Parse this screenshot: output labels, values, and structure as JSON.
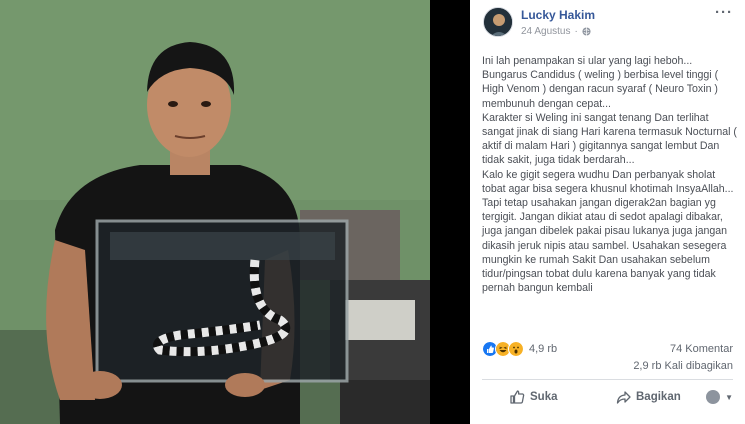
{
  "theme": {
    "link_color": "#365899",
    "text_color": "#4b4f56",
    "meta_color": "#90949c",
    "like_blue": "#1877f2",
    "laugh_yellow": "#f7b125"
  },
  "post": {
    "author": "Lucky Hakim",
    "date": "24 Agustus",
    "privacy_icon": "globe-icon",
    "more_icon": "more-options-icon",
    "text": [
      "Ini lah penampakan si ular yang lagi heboh...",
      "Bungarus Candidus ( weling ) berbisa level tinggi ( High Venom ) dengan racun syaraf ( Neuro Toxin ) membunuh dengan cepat...",
      "Karakter si Weling ini sangat tenang Dan terlihat sangat jinak di siang Hari karena termasuk Nocturnal ( aktif di malam Hari ) gigitannya sangat lembut Dan tidak sakit, juga tidak berdarah...",
      "Kalo ke gigit segera wudhu Dan perbanyak sholat tobat agar bisa segera khusnul khotimah InsyaAllah...",
      "Tapi tetap usahakan jangan digerak2an bagian yg tergigit. Jangan dikiat atau di sedot apalagi dibakar, juga jangan dibelek pakai pisau lukanya juga jangan dikasih jeruk nipis atau sambel. Usahakan sesegera mungkin ke rumah Sakit Dan usahakan sebelum tidur/pingsan tobat dulu karena banyak yang tidak pernah bangun kembali"
    ]
  },
  "stats": {
    "reaction_icons": [
      "like-reaction-icon",
      "haha-reaction-icon",
      "wow-reaction-icon"
    ],
    "reactions": "4,9 rb",
    "comments": "74 Komentar",
    "shares": "2,9 rb Kali dibagikan"
  },
  "actions": {
    "like": "Suka",
    "share": "Bagikan"
  }
}
